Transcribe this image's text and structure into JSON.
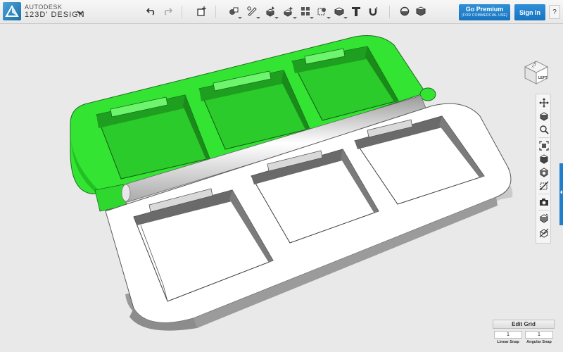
{
  "app": {
    "brand_line1": "AUTODESK",
    "brand_line2": "123D' DESIGN",
    "logo_icon": "autodesk-logo-icon",
    "menu_icon": "chevron-down-icon"
  },
  "toolbar": {
    "tools": [
      {
        "id": "undo",
        "icon": "undo-icon"
      },
      {
        "id": "redo",
        "icon": "redo-icon"
      },
      {
        "id": "transform",
        "icon": "transform-icon"
      },
      {
        "id": "primitives",
        "icon": "primitives-icon"
      },
      {
        "id": "sketch",
        "icon": "sketch-icon"
      },
      {
        "id": "construct",
        "icon": "construct-icon"
      },
      {
        "id": "modify",
        "icon": "modify-icon"
      },
      {
        "id": "pattern",
        "icon": "pattern-icon"
      },
      {
        "id": "grouping",
        "icon": "grouping-icon"
      },
      {
        "id": "combine",
        "icon": "combine-icon"
      },
      {
        "id": "text",
        "icon": "text-icon"
      },
      {
        "id": "snap",
        "icon": "snap-magnet-icon"
      },
      {
        "id": "material",
        "icon": "material-icon"
      }
    ],
    "premium_label": "Go Premium",
    "premium_sub": "(FOR COMMERCIAL USE)",
    "signin_label": "Sign In",
    "help_label": "?"
  },
  "navcube": {
    "face_top": "TOP",
    "face_left": "LEFT"
  },
  "navigation": [
    {
      "id": "pan",
      "icon": "pan-icon"
    },
    {
      "id": "orbit",
      "icon": "orbit-icon"
    },
    {
      "id": "zoom",
      "icon": "zoom-icon"
    },
    {
      "id": "fit",
      "icon": "fit-view-icon"
    },
    {
      "id": "views",
      "icon": "view-cube-icon"
    },
    {
      "id": "visibility",
      "icon": "visibility-icon"
    },
    {
      "id": "hide",
      "icon": "hide-icon"
    },
    {
      "id": "screenshot",
      "icon": "camera-icon"
    },
    {
      "id": "material-toggle",
      "icon": "material-toggle-icon"
    },
    {
      "id": "outline",
      "icon": "outline-toggle-icon"
    }
  ],
  "grid": {
    "title": "Edit Grid",
    "linear_value": "1",
    "angular_value": "1",
    "linear_label": "Linear Snap",
    "angular_label": "Angular Snap"
  },
  "colors": {
    "accent": "#1f7fcc",
    "selected_part": "#2ee82e",
    "part": "#ffffff",
    "background": "#e9e9e9"
  }
}
